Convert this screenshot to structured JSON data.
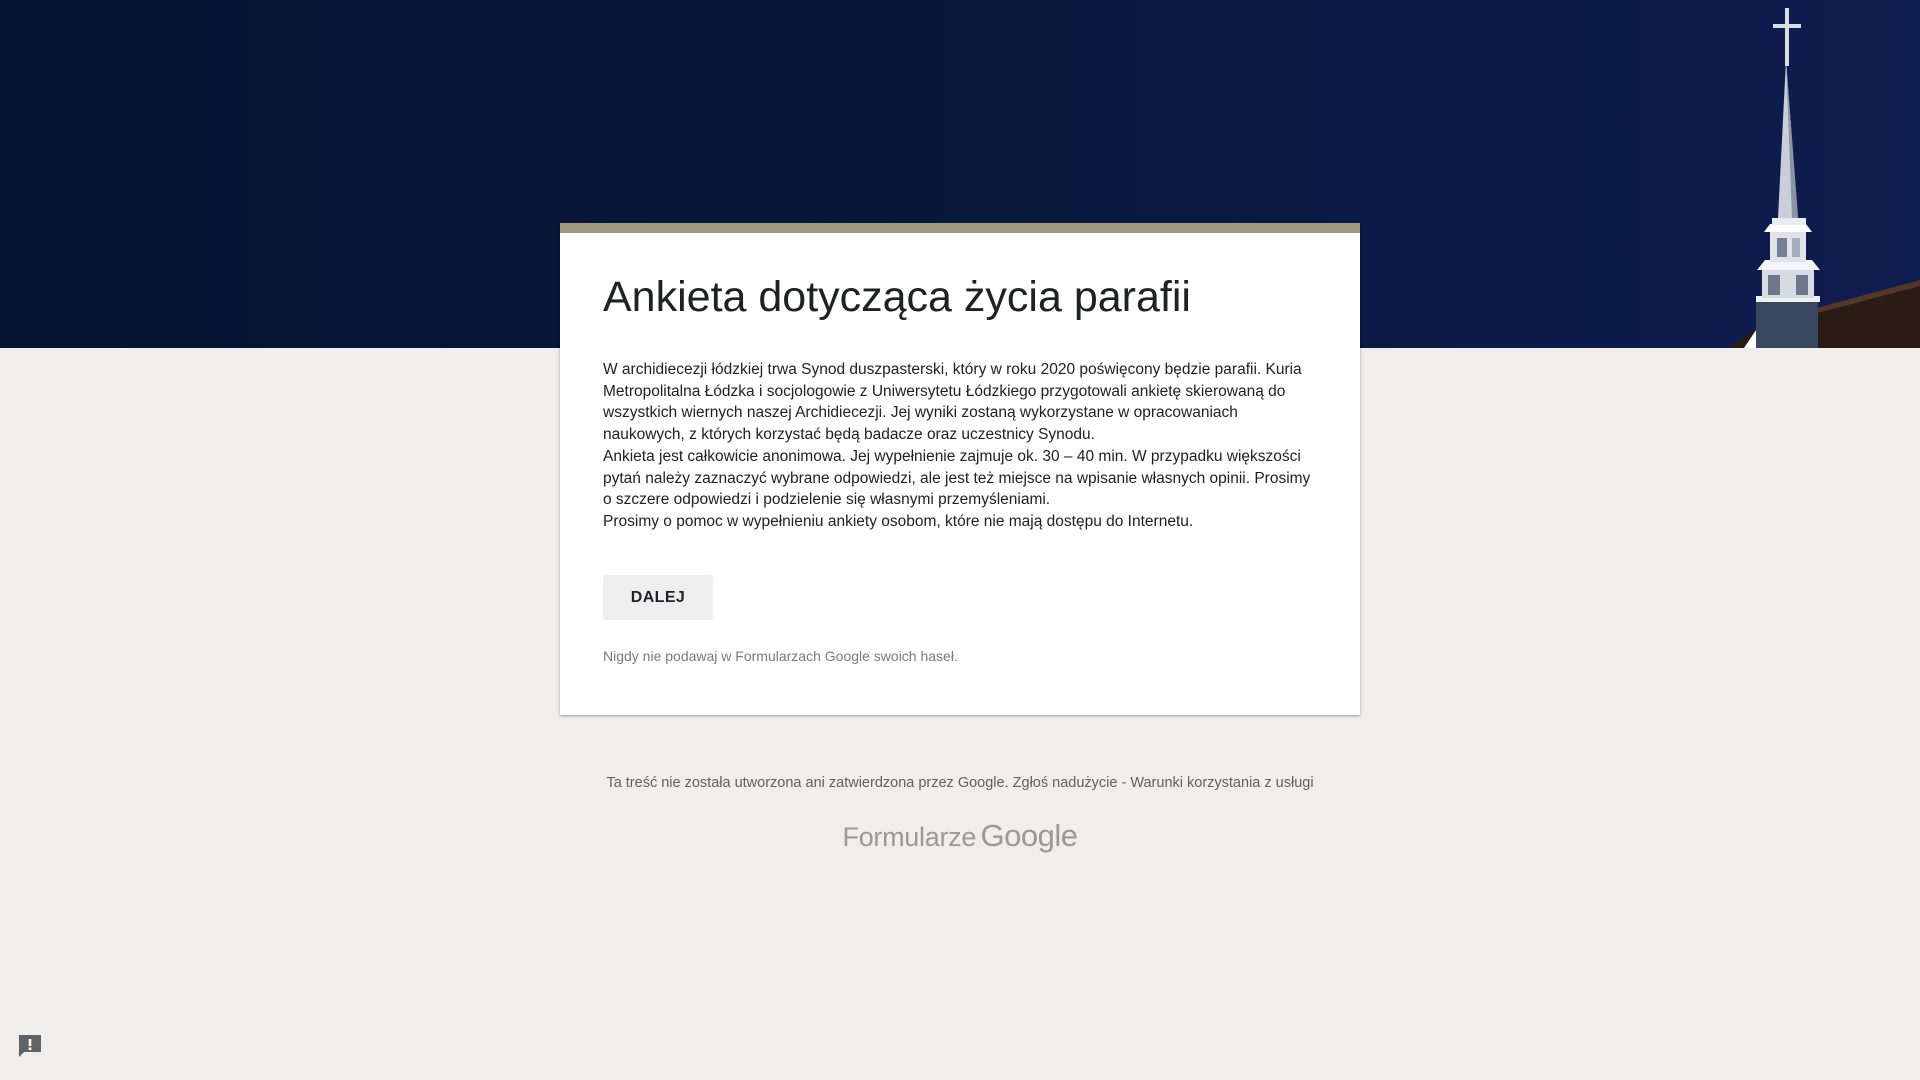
{
  "form": {
    "title": "Ankieta dotycząca życia parafii",
    "description": [
      "W archidiecezji łódzkiej trwa Synod duszpasterski, który w roku 2020 poświęcony będzie parafii. Kuria Metropolitalna Łódzka i socjologowie z Uniwersytetu Łódzkiego przygotowali ankietę skierowaną do wszystkich wiernych naszej Archidiecezji. Jej wyniki zostaną wykorzystane w opracowaniach naukowych, z których korzystać będą badacze oraz uczestnicy Synodu.",
      "Ankieta jest całkowicie anonimowa. Jej wypełnienie zajmuje ok. 30 – 40 min. W przypadku większości pytań należy zaznaczyć wybrane odpowiedzi, ale jest też miejsce na wpisanie własnych opinii. Prosimy o szczere odpowiedzi i podzielenie się własnymi przemyśleniami.",
      "Prosimy o pomoc w wypełnieniu ankiety osobom, które nie mają dostępu do Internetu."
    ],
    "next_button_label": "DALEJ",
    "password_warning": "Nigdy nie podawaj w Formularzach Google swoich haseł."
  },
  "footer": {
    "disclaimer": "Ta treść nie została utworzona ani zatwierdzona przez Google.",
    "report_abuse_link": "Zgłoś nadużycie",
    "separator": "-",
    "terms_link": "Warunki korzystania z usługi"
  },
  "brand": {
    "product": "Formularze",
    "company": "Google"
  },
  "icons": {
    "header_image": "church-steeple-image",
    "feedback": "report-feedback-icon"
  },
  "colors": {
    "header_background": "#0a1640",
    "accent_bar": "#a39880",
    "page_background": "#efeeec",
    "card_background": "#ffffff",
    "button_background": "#eeeeee"
  }
}
